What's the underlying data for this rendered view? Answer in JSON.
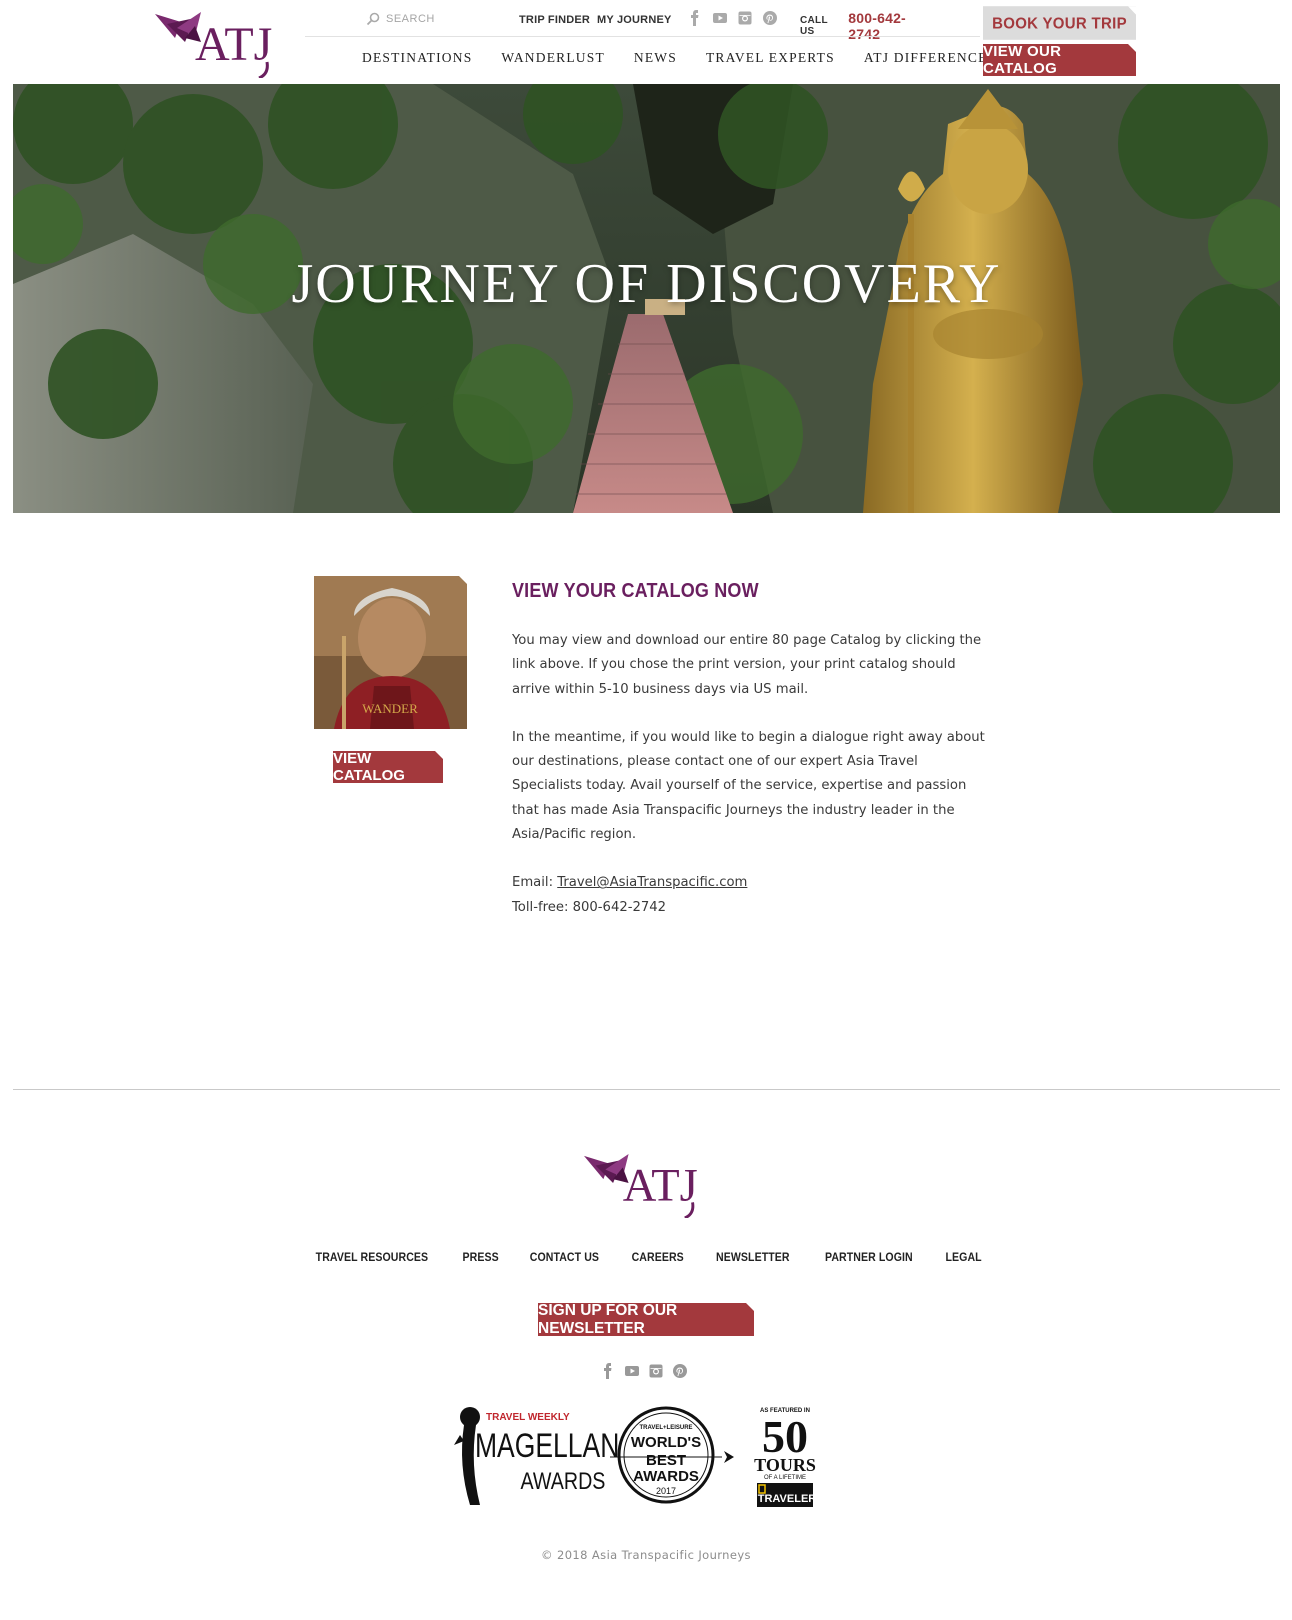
{
  "header": {
    "search_placeholder": "SEARCH",
    "top_links": [
      "TRIP FINDER",
      "MY JOURNEY"
    ],
    "social_icons": [
      "facebook-icon",
      "youtube-icon",
      "instagram-icon",
      "pinterest-icon"
    ],
    "call_label": "CALL US",
    "phone": "800-642-2742",
    "nav": [
      "DESTINATIONS",
      "WANDERLUST",
      "NEWS",
      "TRAVEL EXPERTS",
      "ATJ DIFFERENCE"
    ],
    "book_button": "BOOK YOUR TRIP",
    "catalog_button": "VIEW OUR CATALOG",
    "logo_text": "ATJ"
  },
  "hero": {
    "title": "JOURNEY OF DISCOVERY"
  },
  "catalog": {
    "cover_text": "WANDER",
    "button": "VIEW CATALOG",
    "heading": "VIEW YOUR CATALOG NOW",
    "paragraph_1": "You may view and download our entire 80 page Catalog by clicking the link above. If you chose the print version, your print catalog should arrive within 5-10 business days via US mail.",
    "paragraph_2": "In the meantime, if you would like to begin a dialogue right away about our destinations, please contact one of our expert Asia Travel Specialists today. Avail yourself of the service, expertise and passion that has made Asia Transpacific Journeys the industry leader in the Asia/Pacific region.",
    "email_label": "Email:",
    "email": "Travel@AsiaTranspacific.com",
    "tollfree_label": "Toll-free:",
    "tollfree": "800-642-2742"
  },
  "footer": {
    "logo_text": "ATJ",
    "links": [
      "TRAVEL RESOURCES",
      "PRESS",
      "CONTACT US",
      "CAREERS",
      "NEWSLETTER",
      "PARTNER LOGIN",
      "LEGAL"
    ],
    "signup_button": "SIGN UP FOR OUR NEWSLETTER",
    "social_icons": [
      "facebook-icon",
      "youtube-icon",
      "instagram-icon",
      "pinterest-icon"
    ],
    "awards": {
      "magellan_top": "TRAVEL WEEKLY",
      "magellan_main": "MAGELLAN",
      "magellan_sub": "AWARDS",
      "tl_top": "TRAVEL+LEISURE",
      "tl_line1": "WORLD'S",
      "tl_line2": "BEST",
      "tl_line3": "AWARDS",
      "tl_year": "2017",
      "ng_top": "AS FEATURED IN",
      "ng_num": "50",
      "ng_tours": "TOURS",
      "ng_sub": "OF A LIFETIME",
      "ng_brand": "TRAVELER"
    },
    "copyright": "© 2018 Asia Transpacific Journeys"
  },
  "colors": {
    "brand_purple": "#6a1f5f",
    "brand_red": "#a3393d",
    "button_gray": "#dcdcdc"
  }
}
